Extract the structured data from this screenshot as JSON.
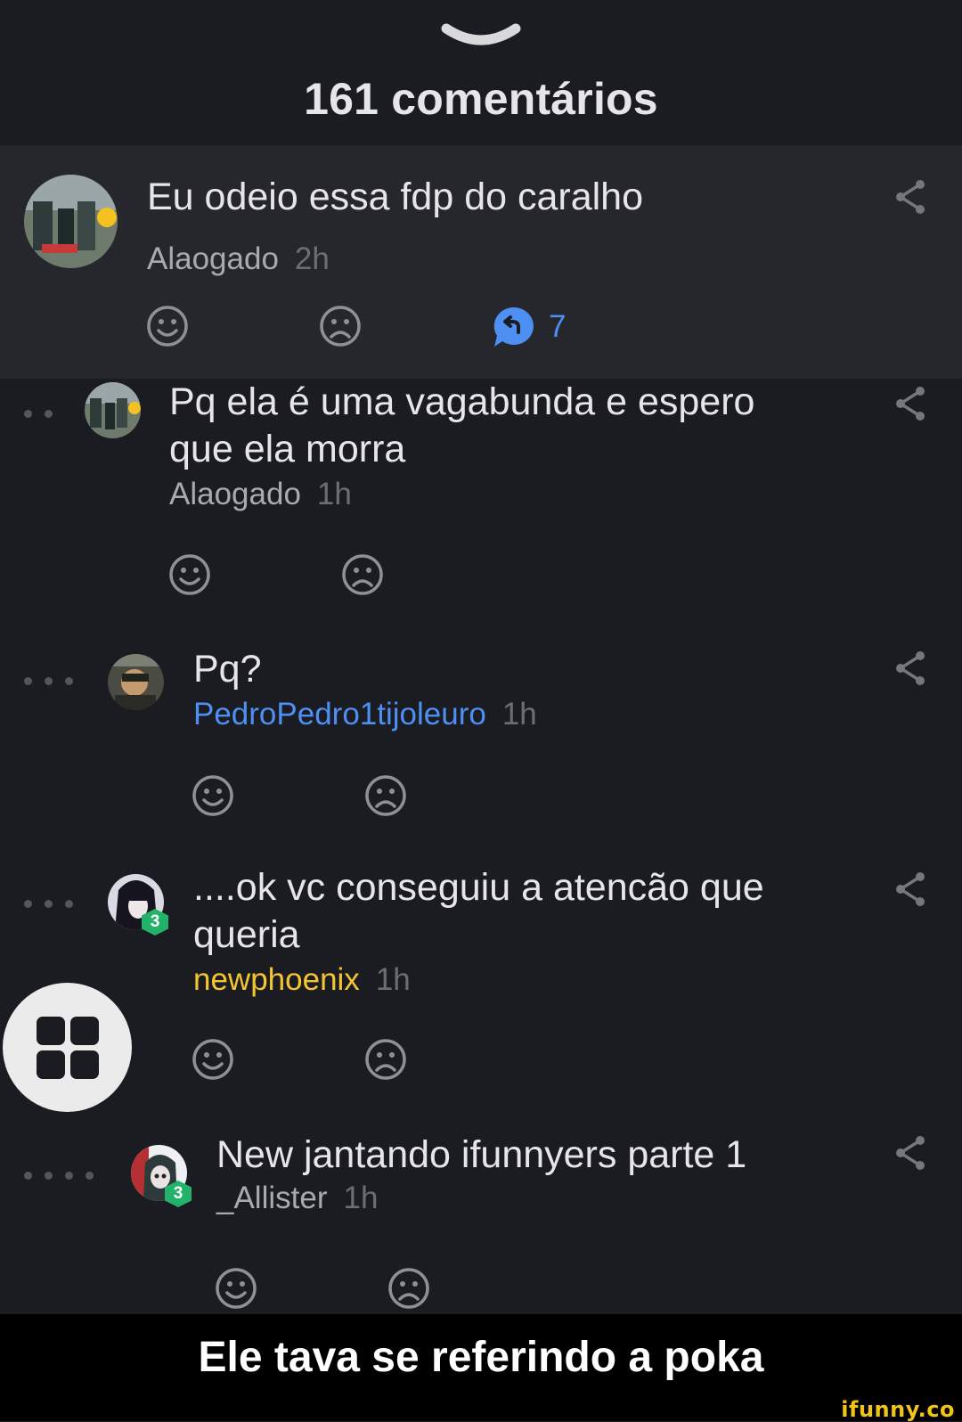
{
  "header": {
    "title": "161 comentários"
  },
  "comments": [
    {
      "text": "Eu odeio essa fdp do caralho",
      "user": "Alaogado",
      "time": "2h",
      "replies": "7"
    },
    {
      "text": "Pq ela é uma vagabunda e espero que ela morra",
      "user": "Alaogado",
      "time": "1h"
    },
    {
      "text": "Pq?",
      "user": "PedroPedro1tijoleuro",
      "time": "1h"
    },
    {
      "text": "....ok vc conseguiu a atencão que queria",
      "user": "newphoenix",
      "time": "1h",
      "badge": "3"
    },
    {
      "text": "New jantando ifunnyers parte 1",
      "user": "_Allister",
      "time": "1h",
      "badge": "3"
    }
  ],
  "caption": "Ele tava se referindo a poka",
  "watermark": "ifunny.co",
  "icons": {
    "grabber": "chevron-down-icon",
    "share": "share-icon",
    "like": "smile-icon",
    "dislike": "frown-icon",
    "reply": "reply-bubble-icon",
    "fab": "grid-menu-icon"
  },
  "colors": {
    "background": "#1b1c21",
    "highlight": "#26272c",
    "link_blue": "#4e8ff4",
    "user_yellow": "#f3c531",
    "badge_green": "#22b26a"
  }
}
